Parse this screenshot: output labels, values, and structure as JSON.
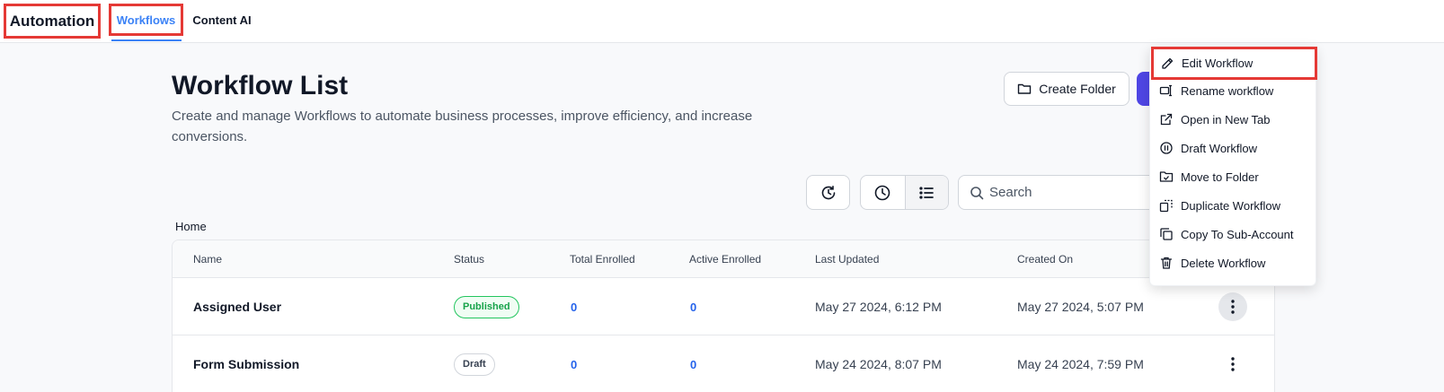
{
  "app": {
    "title": "Automation"
  },
  "tabs": [
    {
      "label": "Workflows",
      "active": true
    },
    {
      "label": "Content AI",
      "active": false
    }
  ],
  "header": {
    "title": "Workflow List",
    "description": "Create and manage Workflows to automate business processes, improve efficiency, and increase conversions.",
    "create_folder_label": "Create Folder"
  },
  "toolbar": {
    "search_placeholder": "Search",
    "history_icon": "history-icon",
    "recent_icon": "clock-icon",
    "list_icon": "list-icon",
    "active_view": "list"
  },
  "breadcrumb": "Home",
  "table": {
    "columns": [
      "Name",
      "Status",
      "Total Enrolled",
      "Active Enrolled",
      "Last Updated",
      "Created On"
    ],
    "rows": [
      {
        "name": "Assigned User",
        "status": "Published",
        "total": "0",
        "active": "0",
        "updated": "May 27 2024, 6:12 PM",
        "created": "May 27 2024, 5:07 PM"
      },
      {
        "name": "Form Submission",
        "status": "Draft",
        "total": "0",
        "active": "0",
        "updated": "May 24 2024, 8:07 PM",
        "created": "May 24 2024, 7:59 PM"
      }
    ]
  },
  "context_menu": {
    "items": [
      {
        "label": "Edit Workflow",
        "icon": "pencil-icon"
      },
      {
        "label": "Rename workflow",
        "icon": "rename-icon"
      },
      {
        "label": "Open in New Tab",
        "icon": "external-link-icon"
      },
      {
        "label": "Draft Workflow",
        "icon": "pause-circle-icon"
      },
      {
        "label": "Move to Folder",
        "icon": "folder-move-icon"
      },
      {
        "label": "Duplicate Workflow",
        "icon": "duplicate-icon"
      },
      {
        "label": "Copy To Sub-Account",
        "icon": "copy-icon"
      },
      {
        "label": "Delete Workflow",
        "icon": "trash-icon"
      }
    ]
  },
  "colors": {
    "accent": "#3b82f6",
    "primary_button": "#4f46e5",
    "published": "#16a34a",
    "highlight_box": "#e53935"
  }
}
